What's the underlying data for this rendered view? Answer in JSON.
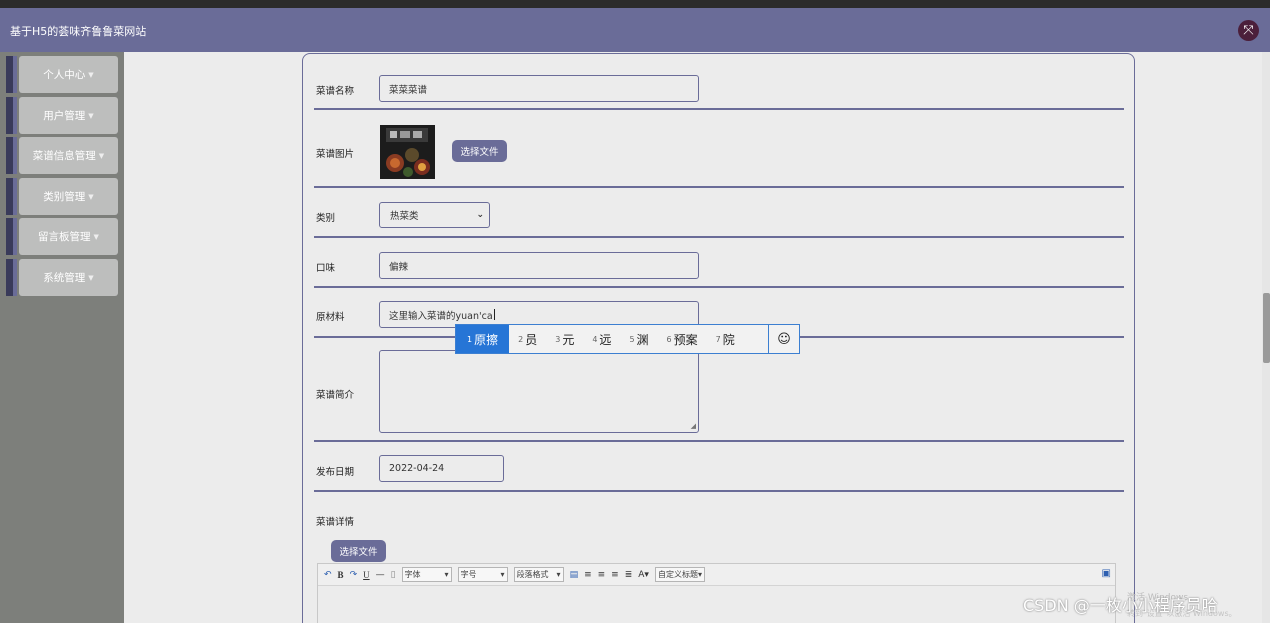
{
  "app": {
    "title": "基于H5的荟味齐鲁鲁菜网站",
    "fullscreen_icon": "expand-arrows-icon"
  },
  "sidebar": {
    "items": [
      {
        "label": "个人中心"
      },
      {
        "label": "用户管理"
      },
      {
        "label": "菜谱信息管理"
      },
      {
        "label": "类别管理"
      },
      {
        "label": "留言板管理"
      },
      {
        "label": "系统管理"
      }
    ],
    "caret": "▼"
  },
  "form": {
    "name_label": "菜谱名称",
    "name_value": "菜菜菜谱",
    "image_label": "菜谱图片",
    "image_button": "选择文件",
    "category_label": "类别",
    "category_value": "热菜类",
    "taste_label": "口味",
    "taste_value": "偏辣",
    "material_label": "原材料",
    "material_value": "这里输入菜谱的yuan'ca",
    "intro_label": "菜谱简介",
    "date_label": "发布日期",
    "date_value": "2022-04-24",
    "detail_label": "菜谱详情",
    "detail_button": "选择文件"
  },
  "ime": {
    "candidates": [
      {
        "num": "1",
        "text": "原擦"
      },
      {
        "num": "2",
        "text": "员"
      },
      {
        "num": "3",
        "text": "元"
      },
      {
        "num": "4",
        "text": "远"
      },
      {
        "num": "5",
        "text": "渊"
      },
      {
        "num": "6",
        "text": "预案"
      },
      {
        "num": "7",
        "text": "院"
      }
    ],
    "emoji": "☺"
  },
  "editor": {
    "font_select": "字体",
    "size_select": "字号",
    "paragraph_select": "段落格式",
    "custom_title_select": "自定义标题"
  },
  "watermark": {
    "text": "CSDN @一枚小小程序员哈",
    "activate_title": "激活 Windows",
    "activate_sub": "转到\"设置\"以激活 Windows。"
  },
  "colors": {
    "accent": "#6a6c98",
    "sidebar_bg": "#7d7f7b",
    "ime_selected": "#2675d6"
  }
}
